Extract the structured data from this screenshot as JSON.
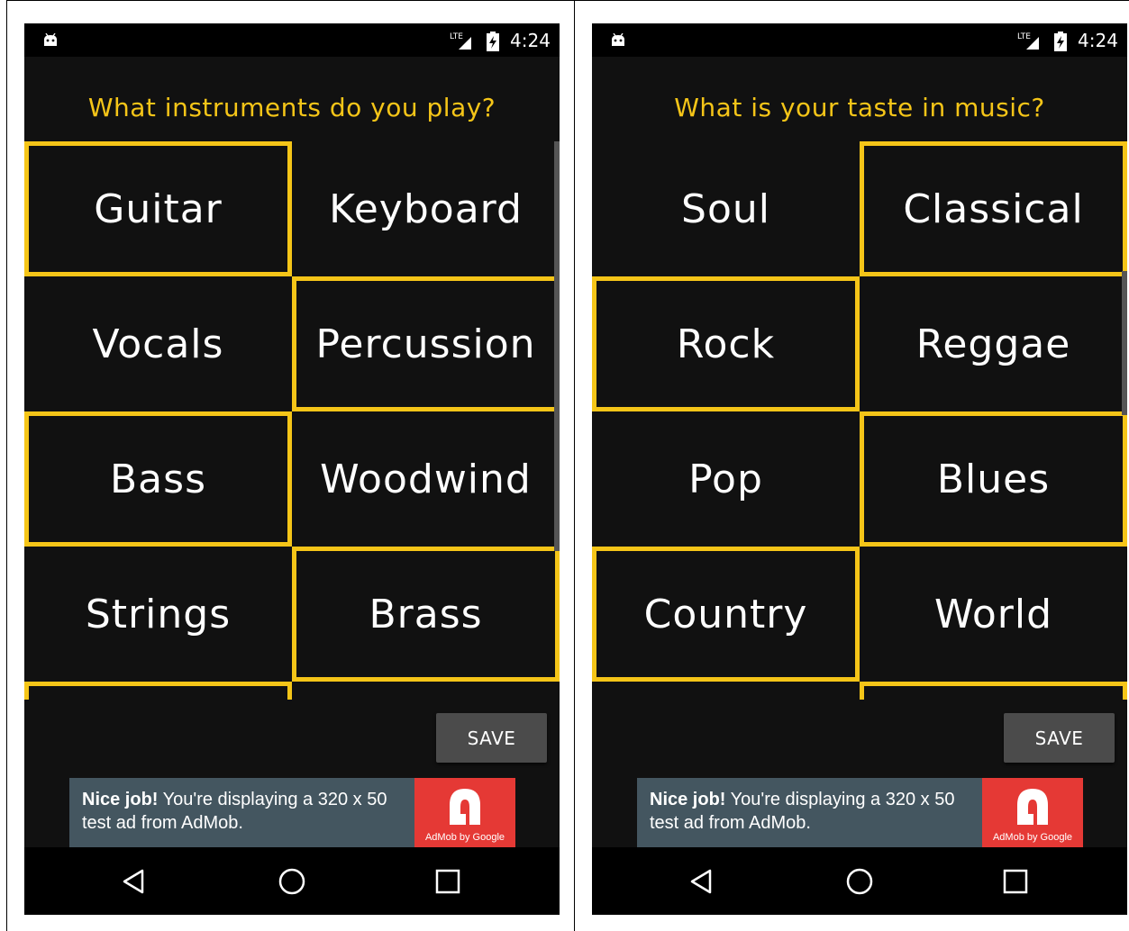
{
  "screens": [
    {
      "status": {
        "time": "4:24",
        "icons": [
          "android-icon",
          "lte-signal-icon",
          "battery-icon"
        ]
      },
      "question": "What instruments do you play?",
      "tiles": [
        {
          "label": "Guitar",
          "selected": true
        },
        {
          "label": "Keyboard",
          "selected": false
        },
        {
          "label": "Vocals",
          "selected": false
        },
        {
          "label": "Percussion",
          "selected": true
        },
        {
          "label": "Bass",
          "selected": true
        },
        {
          "label": "Woodwind",
          "selected": false
        },
        {
          "label": "Strings",
          "selected": false
        },
        {
          "label": "Brass",
          "selected": true
        },
        {
          "label": "",
          "selected": true
        },
        {
          "label": "",
          "selected": false
        }
      ],
      "save_label": "SAVE",
      "ad": {
        "bold": "Nice job!",
        "text": " You're displaying a 320 x 50 test ad from AdMob.",
        "logo_text": "AdMob by Google"
      },
      "nav": [
        "back-icon",
        "home-icon",
        "recents-icon"
      ]
    },
    {
      "status": {
        "time": "4:24",
        "icons": [
          "android-icon",
          "lte-signal-icon",
          "battery-icon"
        ]
      },
      "question": "What is your taste in music?",
      "tiles": [
        {
          "label": "Soul",
          "selected": false
        },
        {
          "label": "Classical",
          "selected": true
        },
        {
          "label": "Rock",
          "selected": true
        },
        {
          "label": "Reggae",
          "selected": false
        },
        {
          "label": "Pop",
          "selected": false
        },
        {
          "label": "Blues",
          "selected": true
        },
        {
          "label": "Country",
          "selected": true
        },
        {
          "label": "World",
          "selected": false
        },
        {
          "label": "",
          "selected": false
        },
        {
          "label": "",
          "selected": true
        }
      ],
      "save_label": "SAVE",
      "ad": {
        "bold": "Nice job!",
        "text": " You're displaying a 320 x 50 test ad from AdMob.",
        "logo_text": "AdMob by Google"
      },
      "nav": [
        "back-icon",
        "home-icon",
        "recents-icon"
      ]
    }
  ],
  "colors": {
    "accent": "#f5c518",
    "background": "#111111",
    "button": "#4b4b4b",
    "ad_bg": "#445660",
    "ad_logo": "#e53935"
  }
}
